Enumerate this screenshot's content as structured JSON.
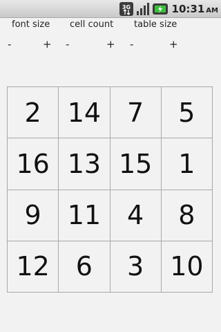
{
  "status_bar": {
    "network": "3G",
    "time": "10:31",
    "ampm": "AM"
  },
  "controls": [
    {
      "label": "font size",
      "minus": "-",
      "plus": "+"
    },
    {
      "label": "cell count",
      "minus": "-",
      "plus": "+"
    },
    {
      "label": "table size",
      "minus": "-",
      "plus": "+"
    }
  ],
  "grid": {
    "cells": [
      "2",
      "14",
      "7",
      "5",
      "16",
      "13",
      "15",
      "1",
      "9",
      "11",
      "4",
      "8",
      "12",
      "6",
      "3",
      "10"
    ]
  },
  "colors": {
    "background": "#f2f2f2",
    "grid_line": "#a8a8a8",
    "battery_green": "#3fbf3f"
  }
}
